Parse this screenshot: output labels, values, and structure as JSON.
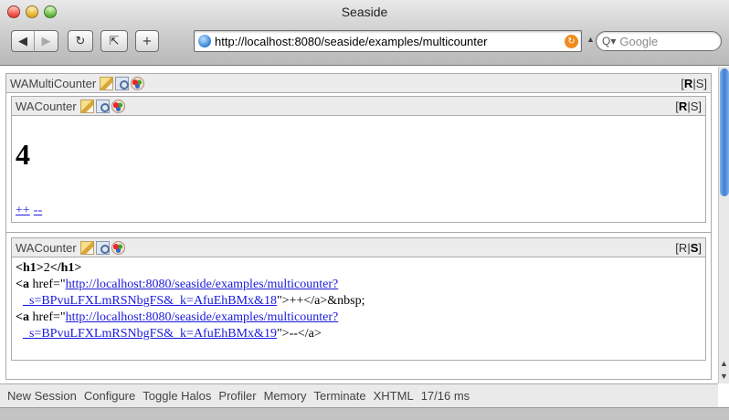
{
  "window": {
    "title": "Seaside"
  },
  "toolbar": {
    "back": "◀",
    "forward": "▶",
    "reload": "↻",
    "snap": "⇱",
    "add": "+",
    "url": "http://localhost:8080/seaside/examples/multicounter",
    "search_placeholder": "Google"
  },
  "multi": {
    "name": "WAMultiCounter",
    "rs": [
      "R",
      "S"
    ]
  },
  "counter1": {
    "name": "WACounter",
    "rs": [
      "R",
      "S"
    ],
    "value": "4",
    "inc": "++",
    "dec": "--"
  },
  "counter2": {
    "name": "WACounter",
    "rs": [
      "R",
      "S"
    ],
    "src": {
      "h1_open": "<h1>",
      "h1_val": "2",
      "h1_close": "</h1>",
      "a_open": "<a",
      "href_attr": " href=\"",
      "link1a": "http://localhost:8080/seaside/examples/multicounter?",
      "link1b": "_s=BPvuLFXLmRSNbgFS&_k=AfuEhBMx&18",
      "tail1": "\">++</a>&nbsp;",
      "link2a": "http://localhost:8080/seaside/examples/multicounter?",
      "link2b": "_s=BPvuLFXLmRSNbgFS&_k=AfuEhBMx&19",
      "tail2": "\">--</a>"
    }
  },
  "devbar": [
    "New Session",
    "Configure",
    "Toggle Halos",
    "Profiler",
    "Memory",
    "Terminate",
    "XHTML",
    "17/16 ms"
  ]
}
